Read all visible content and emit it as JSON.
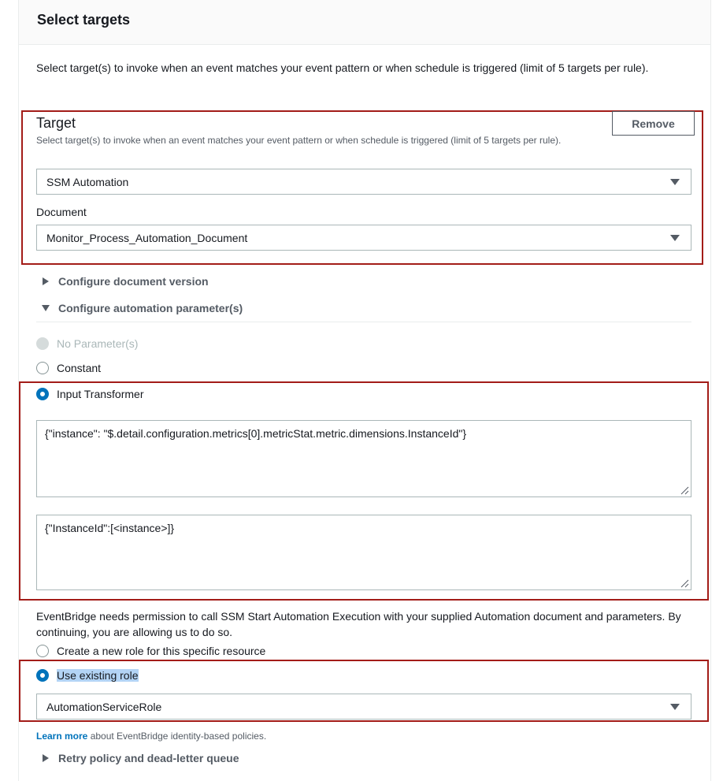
{
  "section": {
    "title": "Select targets",
    "description": "Select target(s) to invoke when an event matches your event pattern or when schedule is triggered (limit of 5 targets per rule)."
  },
  "target": {
    "title": "Target",
    "description": "Select target(s) to invoke when an event matches your event pattern or when schedule is triggered (limit of 5 targets per rule).",
    "remove_label": "Remove",
    "type_value": "SSM Automation",
    "document_label": "Document",
    "document_value": "Monitor_Process_Automation_Document"
  },
  "expanders": {
    "doc_version": "Configure document version",
    "automation_params": "Configure automation parameter(s)",
    "retry": "Retry policy and dead-letter queue"
  },
  "parameters": {
    "options": {
      "none": "No Parameter(s)",
      "constant": "Constant",
      "input_transformer": "Input Transformer"
    },
    "selected": "Input Transformer",
    "input_path": "{\"instance\": \"$.detail.configuration.metrics[0].metricStat.metric.dimensions.InstanceId\"}",
    "input_template": "{\"InstanceId\":[<instance>]}"
  },
  "permission": {
    "text": "EventBridge needs permission to call SSM Start Automation Execution with your supplied Automation document and parameters. By continuing, you are allowing us to do so.",
    "create_role": "Create a new role for this specific resource",
    "use_existing": "Use existing role",
    "role_value": "AutomationServiceRole"
  },
  "learn_more": {
    "link": "Learn more",
    "text": " about EventBridge identity-based policies."
  },
  "colors": {
    "highlight_border": "#a31c18",
    "link": "#0073bb",
    "selected_radio": "#0073bb"
  }
}
